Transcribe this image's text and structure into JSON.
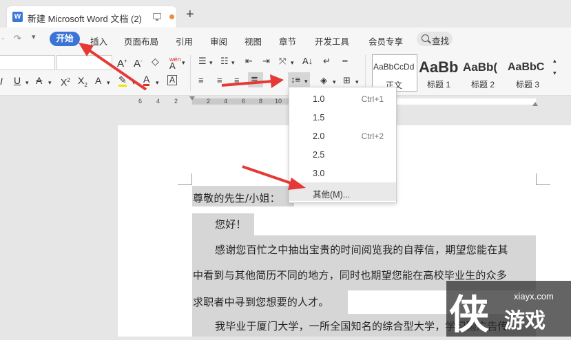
{
  "window": {
    "tab_title": "新建 Microsoft Word 文档 (2)",
    "app_icon": "W",
    "new_tab": "+"
  },
  "menu": {
    "items": [
      "开始",
      "插入",
      "页面布局",
      "引用",
      "审阅",
      "视图",
      "章节",
      "开发工具",
      "会员专享"
    ],
    "search": "查找"
  },
  "ribbon": {
    "styles": [
      {
        "preview": "AaBbCcDd",
        "name": "正文"
      },
      {
        "preview": "AaBb",
        "name": "标题 1"
      },
      {
        "preview": "AaBb(",
        "name": "标题 2"
      },
      {
        "preview": "AaBbC",
        "name": "标题 3"
      }
    ],
    "phonetic_label": "wén"
  },
  "ruler": {
    "numbers": [
      "6",
      "4",
      "2",
      "2",
      "4",
      "6",
      "8",
      "10"
    ]
  },
  "line_spacing_menu": {
    "items": [
      {
        "value": "1.0",
        "shortcut": "Ctrl+1"
      },
      {
        "value": "1.5",
        "shortcut": ""
      },
      {
        "value": "2.0",
        "shortcut": "Ctrl+2"
      },
      {
        "value": "2.5",
        "shortcut": ""
      },
      {
        "value": "3.0",
        "shortcut": ""
      },
      {
        "value": "其他(M)...",
        "shortcut": ""
      }
    ]
  },
  "document": {
    "lines": [
      "尊敬的先生/小姐：",
      "您好！",
      "感谢您百忙之中抽出宝贵的时间阅览我的自荐信，期望您能在其",
      "中看到与其他简历不同的地方，同时也期望您能在高校毕业生的众多",
      "求职者中寻到您想要的人才。",
      "我毕业于厦门大学，一所全国知名的综合型大学，学习国广告传"
    ]
  },
  "watermark": {
    "url": "xiayx.com",
    "char": "侠",
    "text": "游戏"
  },
  "colors": {
    "accent": "#3b74d7",
    "arrow": "#e53935",
    "selection": "#d6d6d6"
  }
}
